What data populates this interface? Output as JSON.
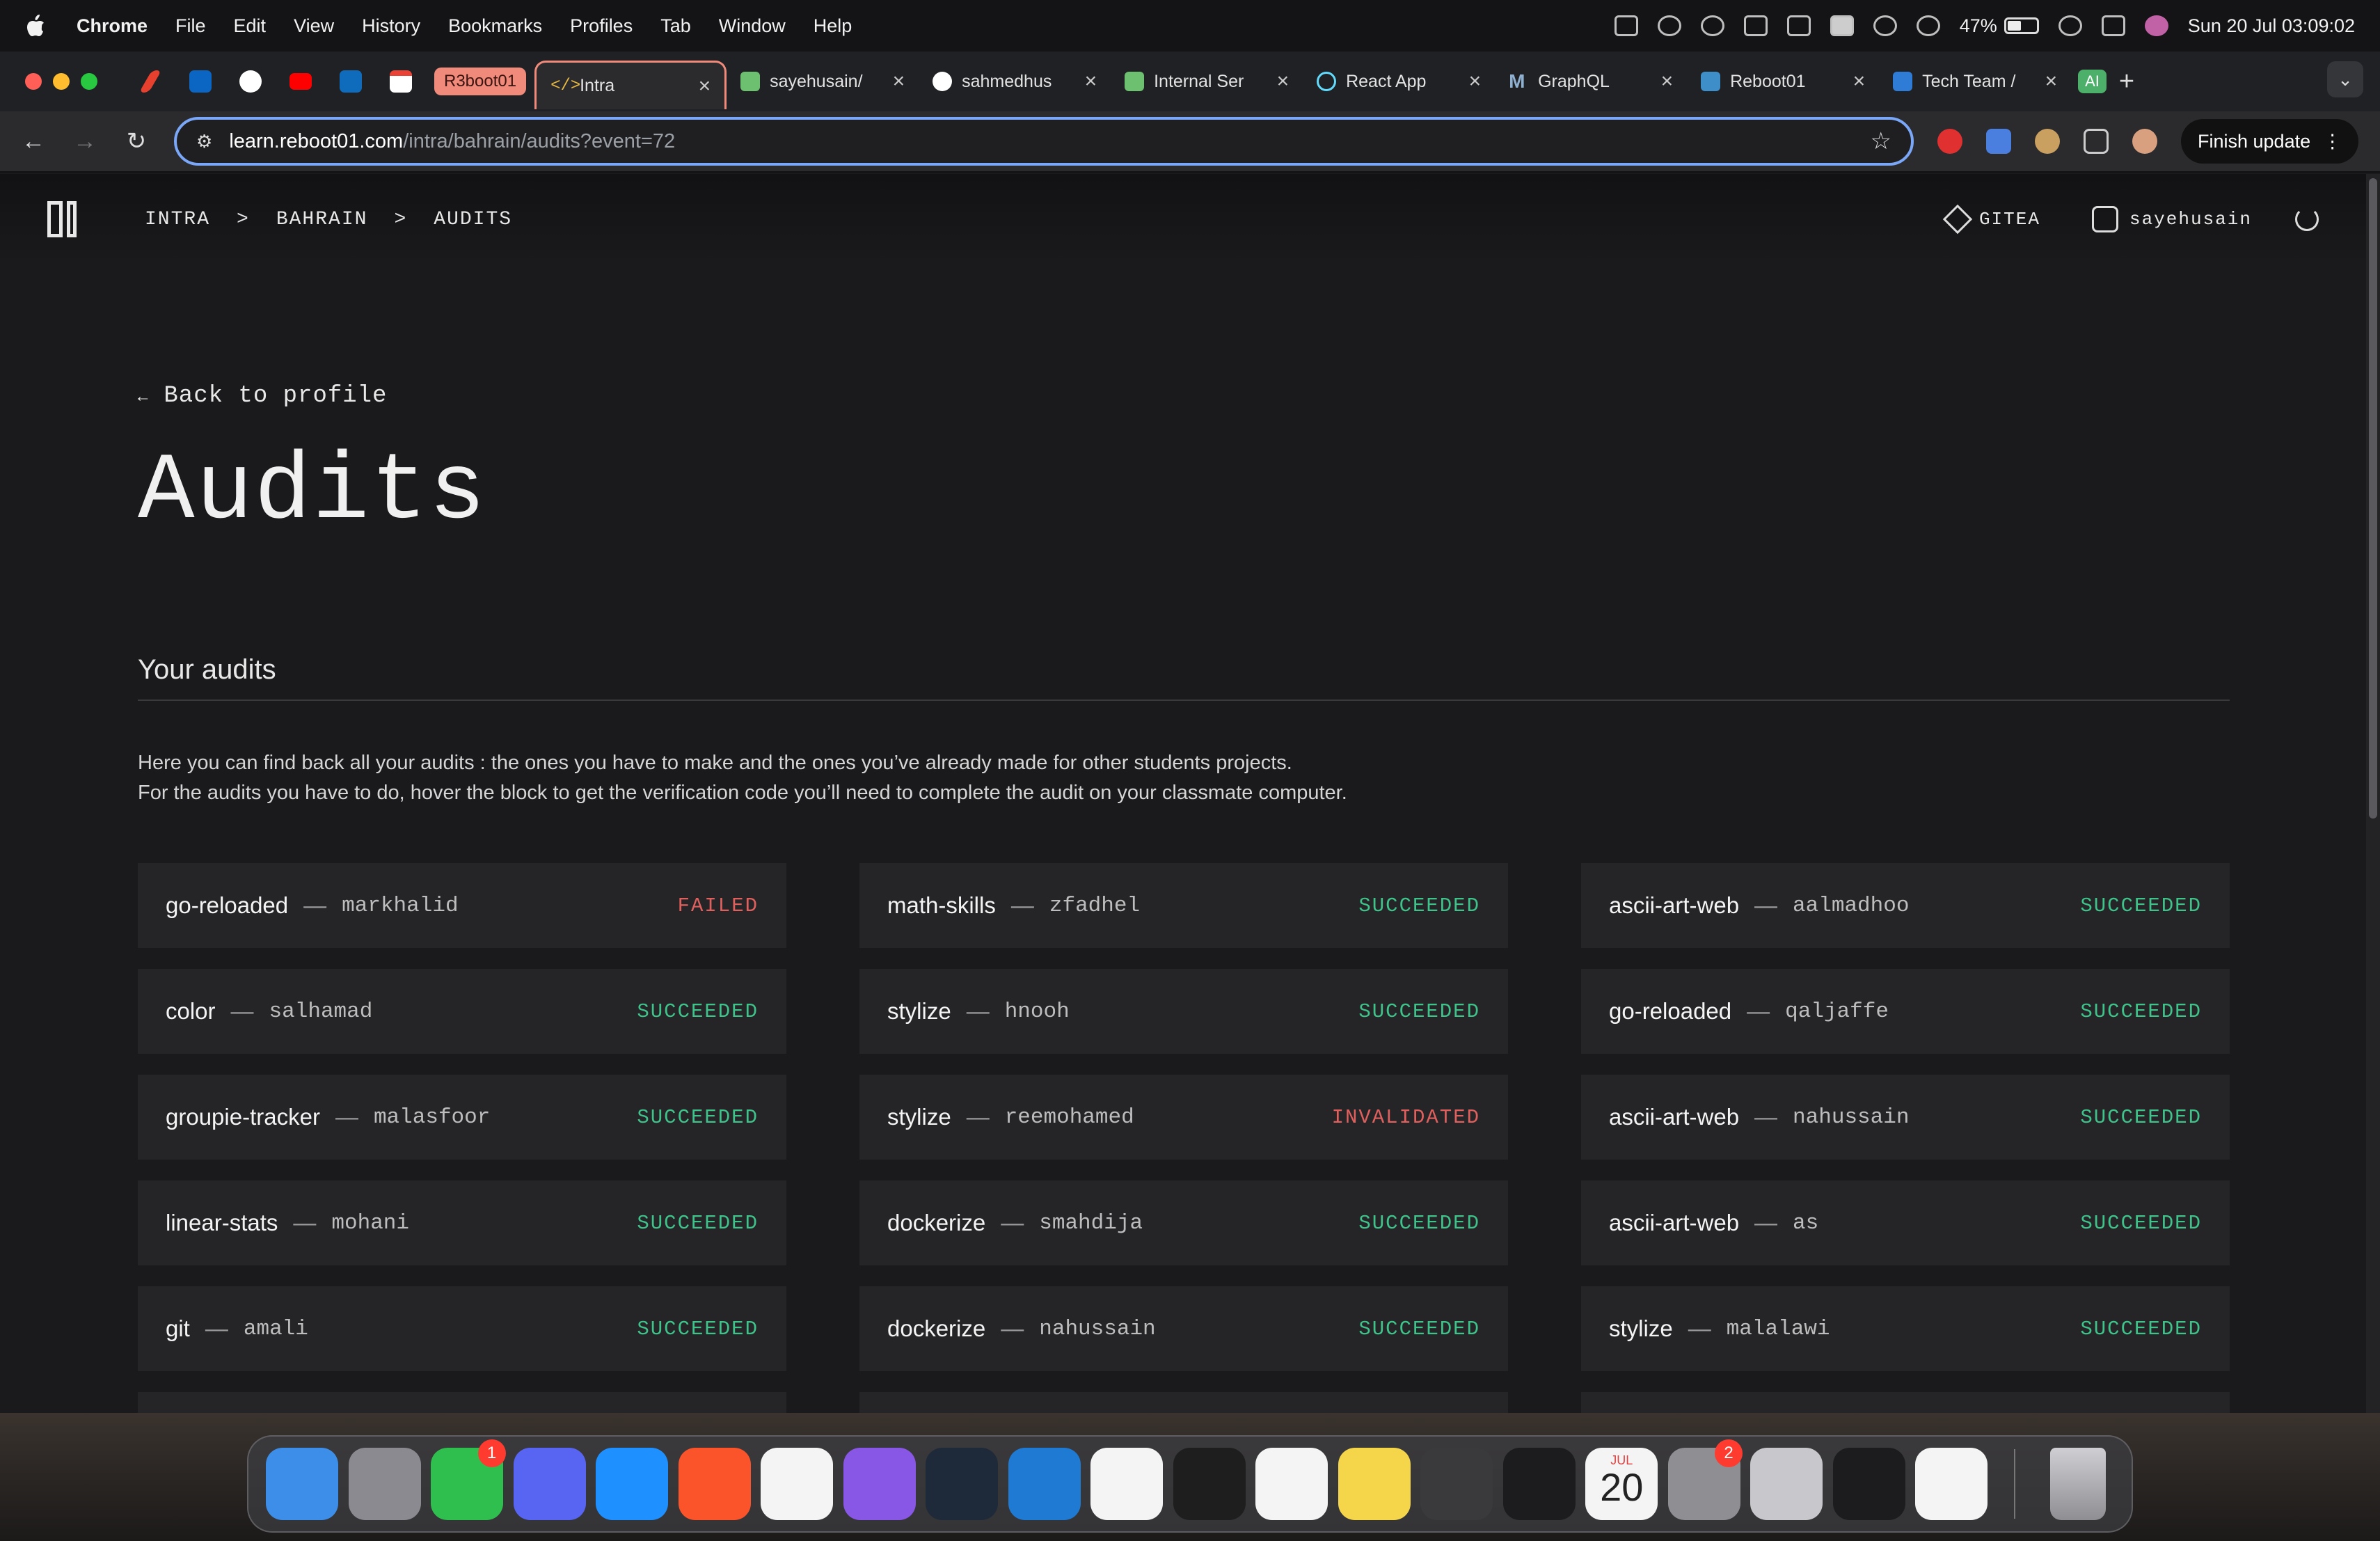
{
  "menubar": {
    "app_name": "Chrome",
    "items": [
      "File",
      "Edit",
      "View",
      "History",
      "Bookmarks",
      "Profiles",
      "Tab",
      "Window",
      "Help"
    ],
    "battery": "47%",
    "clock": "Sun 20 Jul  03:09:02"
  },
  "tabs": {
    "group_label": "R3boot01",
    "list": [
      {
        "label": "Intra",
        "active": true
      },
      {
        "label": "sayehusain/"
      },
      {
        "label": "sahmedhus"
      },
      {
        "label": "Internal Ser"
      },
      {
        "label": "React App"
      },
      {
        "label": "GraphQL"
      },
      {
        "label": "Reboot01"
      },
      {
        "label": "Tech Team /"
      }
    ],
    "ai_label": "AI"
  },
  "toolbar": {
    "url_host": "learn.reboot01.com",
    "url_path": "/intra/bahrain/audits?event=72",
    "finish_update": "Finish update"
  },
  "header": {
    "crumbs": [
      "INTRA",
      "BAHRAIN",
      "AUDITS"
    ],
    "separator": ">",
    "gitea": "GITEA",
    "username": "sayehusain"
  },
  "page": {
    "back": "Back to profile",
    "back_arrow": "←",
    "title": "Audits",
    "section_title": "Your audits",
    "desc_line1": "Here you can find back all your audits : the ones you have to make and the ones you’ve already made for other students projects.",
    "desc_line2": "For the audits you have to do, hover the block to get the verification code you’ll need to complete the audit on your classmate computer."
  },
  "audits": [
    {
      "project": "go-reloaded",
      "user": "markhalid",
      "status": "FAILED"
    },
    {
      "project": "math-skills",
      "user": "zfadhel",
      "status": "SUCCEEDED"
    },
    {
      "project": "ascii-art-web",
      "user": "aalmadhoo",
      "status": "SUCCEEDED"
    },
    {
      "project": "color",
      "user": "salhamad",
      "status": "SUCCEEDED"
    },
    {
      "project": "stylize",
      "user": "hnooh",
      "status": "SUCCEEDED"
    },
    {
      "project": "go-reloaded",
      "user": "qaljaffe",
      "status": "SUCCEEDED"
    },
    {
      "project": "groupie-tracker",
      "user": "malasfoor",
      "status": "SUCCEEDED"
    },
    {
      "project": "stylize",
      "user": "reemohamed",
      "status": "INVALIDATED"
    },
    {
      "project": "ascii-art-web",
      "user": "nahussain",
      "status": "SUCCEEDED"
    },
    {
      "project": "linear-stats",
      "user": "mohani",
      "status": "SUCCEEDED"
    },
    {
      "project": "dockerize",
      "user": "smahdija",
      "status": "SUCCEEDED"
    },
    {
      "project": "ascii-art-web",
      "user": "as",
      "status": "SUCCEEDED"
    },
    {
      "project": "git",
      "user": "amali",
      "status": "SUCCEEDED"
    },
    {
      "project": "dockerize",
      "user": "nahussain",
      "status": "SUCCEEDED"
    },
    {
      "project": "stylize",
      "user": "malalawi",
      "status": "SUCCEEDED"
    }
  ],
  "dash": "—",
  "colors": {
    "succeeded": "#3ec38a",
    "failed": "#e0605e",
    "tab_group": "#f08a7a"
  },
  "dock": {
    "apps": [
      "finder-icon",
      "launchpad-icon",
      "whatsapp-icon",
      "discord-icon",
      "safari-icon",
      "brave-icon",
      "chrome-icon",
      "github-desktop-icon",
      "terminus-icon",
      "vscode-icon",
      "photos-icon",
      "figma-icon",
      "freeform-icon",
      "notes-icon",
      "calculator-icon",
      "activity-monitor-icon",
      "calendar-icon",
      "system-settings-icon",
      "iphone-mirroring-icon",
      "terminal-icon",
      "chatgpt-icon"
    ],
    "whatsapp_badge": "1",
    "settings_badge": "2",
    "calendar_month": "JUL",
    "calendar_day": "20"
  }
}
